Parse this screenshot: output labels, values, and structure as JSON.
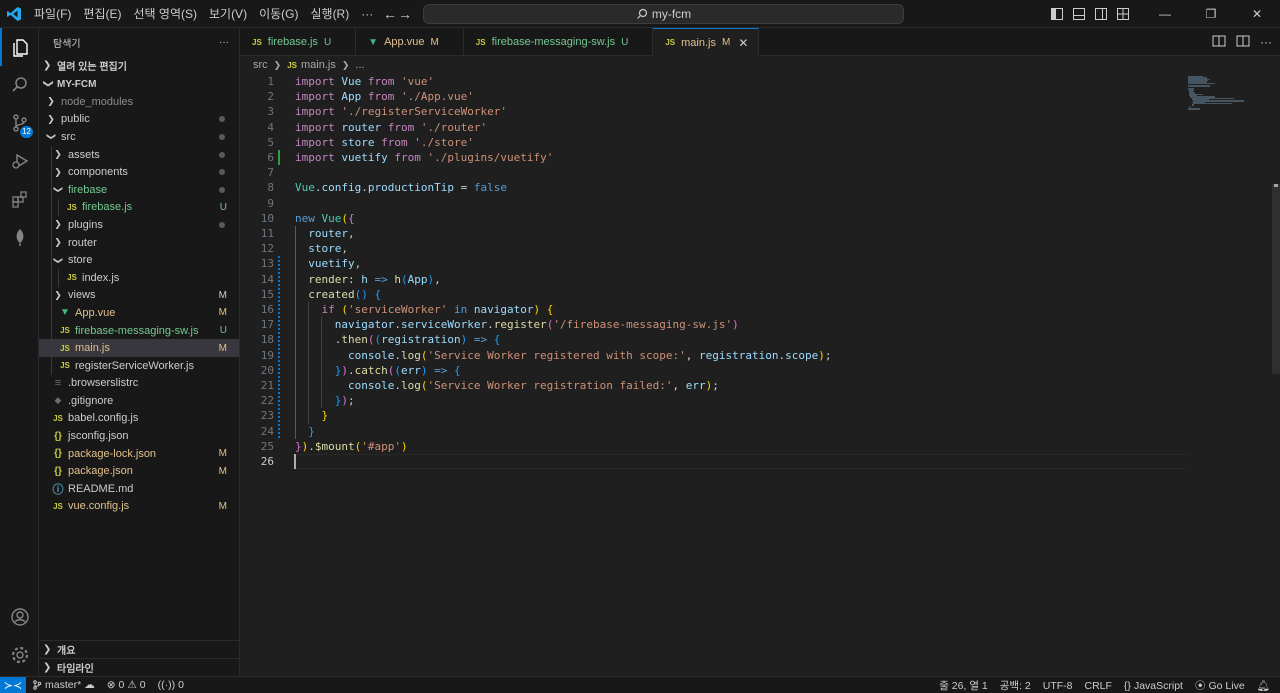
{
  "titlebar": {
    "menu": [
      "파일(F)",
      "편집(E)",
      "선택 영역(S)",
      "보기(V)",
      "이동(G)",
      "실행(R)",
      "···"
    ],
    "search_text": "my-fcm",
    "window_controls": [
      "—",
      "❐",
      "✕"
    ]
  },
  "activity": {
    "scm_badge": "12"
  },
  "sidebar": {
    "title": "탐색기",
    "more": "···",
    "open_editors": "열려 있는 편집기",
    "project": "MY-FCM",
    "tree": [
      {
        "label": "node_modules",
        "indent": 1,
        "type": "folder",
        "open": false,
        "color": "grey",
        "deco": ""
      },
      {
        "label": "public",
        "indent": 1,
        "type": "folder",
        "open": false,
        "color": "normal",
        "deco": "dot"
      },
      {
        "label": "src",
        "indent": 1,
        "type": "folder",
        "open": true,
        "color": "normal",
        "deco": "dot"
      },
      {
        "label": "assets",
        "indent": 2,
        "type": "folder",
        "open": false,
        "color": "normal",
        "deco": "dot"
      },
      {
        "label": "components",
        "indent": 2,
        "type": "folder",
        "open": false,
        "color": "normal",
        "deco": "dot"
      },
      {
        "label": "firebase",
        "indent": 2,
        "type": "folder",
        "open": true,
        "color": "green",
        "deco": "dot"
      },
      {
        "label": "firebase.js",
        "indent": 3,
        "type": "js",
        "color": "green",
        "deco": "U"
      },
      {
        "label": "plugins",
        "indent": 2,
        "type": "folder",
        "open": false,
        "color": "normal",
        "deco": "dot"
      },
      {
        "label": "router",
        "indent": 2,
        "type": "folder",
        "open": false,
        "color": "normal",
        "deco": ""
      },
      {
        "label": "store",
        "indent": 2,
        "type": "folder",
        "open": true,
        "color": "normal",
        "deco": ""
      },
      {
        "label": "index.js",
        "indent": 3,
        "type": "js",
        "color": "normal",
        "deco": ""
      },
      {
        "label": "views",
        "indent": 2,
        "type": "folder",
        "open": false,
        "color": "normal",
        "deco": "M"
      },
      {
        "label": "App.vue",
        "indent": 2,
        "type": "vue",
        "color": "yellow",
        "deco": "M"
      },
      {
        "label": "firebase-messaging-sw.js",
        "indent": 2,
        "type": "js",
        "color": "green",
        "deco": "U"
      },
      {
        "label": "main.js",
        "indent": 2,
        "type": "js",
        "color": "yellow",
        "deco": "M",
        "selected": true
      },
      {
        "label": "registerServiceWorker.js",
        "indent": 2,
        "type": "js",
        "color": "normal",
        "deco": ""
      },
      {
        "label": ".browserslistrc",
        "indent": 1,
        "type": "plain",
        "color": "normal",
        "deco": ""
      },
      {
        "label": ".gitignore",
        "indent": 1,
        "type": "git",
        "color": "normal",
        "deco": ""
      },
      {
        "label": "babel.config.js",
        "indent": 1,
        "type": "js",
        "color": "normal",
        "deco": ""
      },
      {
        "label": "jsconfig.json",
        "indent": 1,
        "type": "json",
        "color": "normal",
        "deco": ""
      },
      {
        "label": "package-lock.json",
        "indent": 1,
        "type": "json",
        "color": "yellow",
        "deco": "M"
      },
      {
        "label": "package.json",
        "indent": 1,
        "type": "json",
        "color": "yellow",
        "deco": "M"
      },
      {
        "label": "README.md",
        "indent": 1,
        "type": "info",
        "color": "normal",
        "deco": ""
      },
      {
        "label": "vue.config.js",
        "indent": 1,
        "type": "js",
        "color": "yellow",
        "deco": "M"
      }
    ],
    "outline": "개요",
    "timeline": "타임라인"
  },
  "tabs": [
    {
      "label": "firebase.js",
      "icon": "JS",
      "state": "U",
      "color": "green",
      "active": false
    },
    {
      "label": "App.vue",
      "icon": "V",
      "state": "M",
      "color": "yellow",
      "active": false
    },
    {
      "label": "firebase-messaging-sw.js",
      "icon": "JS",
      "state": "U",
      "color": "green",
      "active": false
    },
    {
      "label": "main.js",
      "icon": "JS",
      "state": "M",
      "color": "yellow",
      "active": true
    }
  ],
  "breadcrumb": {
    "folder": "src",
    "file": "main.js",
    "symbol": "..."
  },
  "editor": {
    "current_line": 26,
    "lines": [
      [
        [
          "kw2",
          "import"
        ],
        [
          "p",
          " "
        ],
        [
          "vr",
          "Vue"
        ],
        [
          "p",
          " "
        ],
        [
          "kw2",
          "from"
        ],
        [
          "p",
          " "
        ],
        [
          "str",
          "'vue'"
        ]
      ],
      [
        [
          "kw2",
          "import"
        ],
        [
          "p",
          " "
        ],
        [
          "vr",
          "App"
        ],
        [
          "p",
          " "
        ],
        [
          "kw2",
          "from"
        ],
        [
          "p",
          " "
        ],
        [
          "str",
          "'./App.vue'"
        ]
      ],
      [
        [
          "kw2",
          "import"
        ],
        [
          "p",
          " "
        ],
        [
          "str",
          "'./registerServiceWorker'"
        ]
      ],
      [
        [
          "kw2",
          "import"
        ],
        [
          "p",
          " "
        ],
        [
          "vr",
          "router"
        ],
        [
          "p",
          " "
        ],
        [
          "kw2",
          "from"
        ],
        [
          "p",
          " "
        ],
        [
          "str",
          "'./router'"
        ]
      ],
      [
        [
          "kw2",
          "import"
        ],
        [
          "p",
          " "
        ],
        [
          "vr",
          "store"
        ],
        [
          "p",
          " "
        ],
        [
          "kw2",
          "from"
        ],
        [
          "p",
          " "
        ],
        [
          "str",
          "'./store'"
        ]
      ],
      [
        [
          "kw2",
          "import"
        ],
        [
          "p",
          " "
        ],
        [
          "vr",
          "vuetify"
        ],
        [
          "p",
          " "
        ],
        [
          "kw2",
          "from"
        ],
        [
          "p",
          " "
        ],
        [
          "str",
          "'./plugins/vuetify'"
        ]
      ],
      [],
      [
        [
          "cls",
          "Vue"
        ],
        [
          "p",
          "."
        ],
        [
          "vr",
          "config"
        ],
        [
          "p",
          "."
        ],
        [
          "vr",
          "productionTip"
        ],
        [
          "p",
          " = "
        ],
        [
          "kw",
          "false"
        ]
      ],
      [],
      [
        [
          "kw",
          "new"
        ],
        [
          "p",
          " "
        ],
        [
          "cls",
          "Vue"
        ],
        [
          "br1",
          "("
        ],
        [
          "br2",
          "{"
        ]
      ],
      [
        [
          "p",
          "  "
        ],
        [
          "vr",
          "router"
        ],
        [
          "p",
          ","
        ]
      ],
      [
        [
          "p",
          "  "
        ],
        [
          "vr",
          "store"
        ],
        [
          "p",
          ","
        ]
      ],
      [
        [
          "p",
          "  "
        ],
        [
          "vr",
          "vuetify"
        ],
        [
          "p",
          ","
        ]
      ],
      [
        [
          "p",
          "  "
        ],
        [
          "fn",
          "render"
        ],
        [
          "p",
          ": "
        ],
        [
          "vr",
          "h"
        ],
        [
          "p",
          " "
        ],
        [
          "kw",
          "=>"
        ],
        [
          "p",
          " "
        ],
        [
          "fn",
          "h"
        ],
        [
          "br3",
          "("
        ],
        [
          "vr",
          "App"
        ],
        [
          "br3",
          ")"
        ],
        [
          "p",
          ","
        ]
      ],
      [
        [
          "p",
          "  "
        ],
        [
          "fn",
          "created"
        ],
        [
          "br3",
          "()"
        ],
        [
          "p",
          " "
        ],
        [
          "br3",
          "{"
        ]
      ],
      [
        [
          "p",
          "    "
        ],
        [
          "kw2",
          "if"
        ],
        [
          "p",
          " "
        ],
        [
          "br1",
          "("
        ],
        [
          "str",
          "'serviceWorker'"
        ],
        [
          "p",
          " "
        ],
        [
          "kw",
          "in"
        ],
        [
          "p",
          " "
        ],
        [
          "vr",
          "navigator"
        ],
        [
          "br1",
          ")"
        ],
        [
          "p",
          " "
        ],
        [
          "br1",
          "{"
        ]
      ],
      [
        [
          "p",
          "      "
        ],
        [
          "vr",
          "navigator"
        ],
        [
          "p",
          "."
        ],
        [
          "vr",
          "serviceWorker"
        ],
        [
          "p",
          "."
        ],
        [
          "fn",
          "register"
        ],
        [
          "br2",
          "("
        ],
        [
          "str",
          "'/firebase-messaging-sw.js'"
        ],
        [
          "br2",
          ")"
        ]
      ],
      [
        [
          "p",
          "      ."
        ],
        [
          "fn",
          "then"
        ],
        [
          "br2",
          "("
        ],
        [
          "br3",
          "("
        ],
        [
          "vr",
          "registration"
        ],
        [
          "br3",
          ")"
        ],
        [
          "p",
          " "
        ],
        [
          "kw",
          "=>"
        ],
        [
          "p",
          " "
        ],
        [
          "br3",
          "{"
        ]
      ],
      [
        [
          "p",
          "        "
        ],
        [
          "vr",
          "console"
        ],
        [
          "p",
          "."
        ],
        [
          "fn",
          "log"
        ],
        [
          "br1",
          "("
        ],
        [
          "str",
          "'Service Worker registered with scope:'"
        ],
        [
          "p",
          ", "
        ],
        [
          "vr",
          "registration"
        ],
        [
          "p",
          "."
        ],
        [
          "vr",
          "scope"
        ],
        [
          "br1",
          ")"
        ],
        [
          "p",
          ";"
        ]
      ],
      [
        [
          "p",
          "      "
        ],
        [
          "br3",
          "}"
        ],
        [
          "br2",
          ")"
        ],
        [
          "p",
          "."
        ],
        [
          "fn",
          "catch"
        ],
        [
          "br2",
          "("
        ],
        [
          "br3",
          "("
        ],
        [
          "vr",
          "err"
        ],
        [
          "br3",
          ")"
        ],
        [
          "p",
          " "
        ],
        [
          "kw",
          "=>"
        ],
        [
          "p",
          " "
        ],
        [
          "br3",
          "{"
        ]
      ],
      [
        [
          "p",
          "        "
        ],
        [
          "vr",
          "console"
        ],
        [
          "p",
          "."
        ],
        [
          "fn",
          "log"
        ],
        [
          "br1",
          "("
        ],
        [
          "str",
          "'Service Worker registration failed:'"
        ],
        [
          "p",
          ", "
        ],
        [
          "vr",
          "err"
        ],
        [
          "br1",
          ")"
        ],
        [
          "p",
          ";"
        ]
      ],
      [
        [
          "p",
          "      "
        ],
        [
          "br3",
          "}"
        ],
        [
          "br2",
          ")"
        ],
        [
          "p",
          ";"
        ]
      ],
      [
        [
          "p",
          "    "
        ],
        [
          "br1",
          "}"
        ]
      ],
      [
        [
          "p",
          "  "
        ],
        [
          "br3",
          "}"
        ]
      ],
      [
        [
          "br2",
          "}"
        ],
        [
          "br1",
          ")"
        ],
        [
          "p",
          "."
        ],
        [
          "fn",
          "$mount"
        ],
        [
          "br1",
          "("
        ],
        [
          "str",
          "'#app'"
        ],
        [
          "br1",
          ")"
        ]
      ],
      []
    ]
  },
  "statusbar": {
    "branch": "master*",
    "errors": "0",
    "warnings": "0",
    "ports": "0",
    "position": "줄 26, 열 1",
    "spaces": "공백: 2",
    "encoding": "UTF-8",
    "eol": "CRLF",
    "language": "JavaScript",
    "golive": "Go Live"
  },
  "colors": {
    "accent": "#0078d4",
    "untracked": "#73c991",
    "modified": "#e2c08d"
  }
}
